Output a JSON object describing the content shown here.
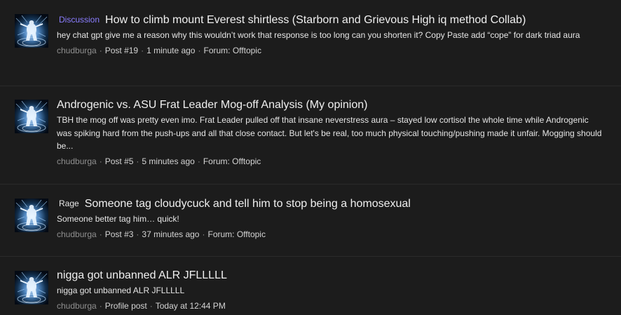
{
  "results": [
    {
      "prefix": "Discussion",
      "prefix_color": "#8a7dff",
      "title": "How to climb mount Everest shirtless (Starborn and Grievous High iq method Collab)",
      "snippet": "hey chat gpt give me a reason why this wouldn’t work that response is too long can you shorten it? Copy Paste add “cope” for dark triad aura",
      "author": "chudburga",
      "meta": [
        "Post #19",
        "1 minute ago",
        "Forum: Offtopic"
      ]
    },
    {
      "prefix": "",
      "title": "Androgenic vs. ASU Frat Leader Mog-off Analysis (My opinion)",
      "snippet": "TBH the mog off was pretty even imo. Frat Leader pulled off that insane neverstress aura – stayed low cortisol the whole time while Androgenic was spiking hard from the push-ups and all that close contact. But let's be real, too much physical touching/pushing made it unfair. Mogging should be...",
      "author": "chudburga",
      "meta": [
        "Post #5",
        "5 minutes ago",
        "Forum: Offtopic"
      ]
    },
    {
      "prefix": "Rage",
      "prefix_color": "#e8e8e8",
      "title": "Someone tag cloudycuck and tell him to stop being a homosexual",
      "snippet": "Someone better tag him… quick!",
      "author": "chudburga",
      "meta": [
        "Post #3",
        "37 minutes ago",
        "Forum: Offtopic"
      ]
    },
    {
      "prefix": "",
      "title": "nigga got unbanned ALR JFLLLLL",
      "snippet": "nigga got unbanned ALR JFLLLLL",
      "author": "chudburga",
      "meta": [
        "Profile post",
        "Today at 12:44 PM"
      ]
    }
  ],
  "icons": {
    "avatar": "user-avatar-icon",
    "separator": "·"
  }
}
